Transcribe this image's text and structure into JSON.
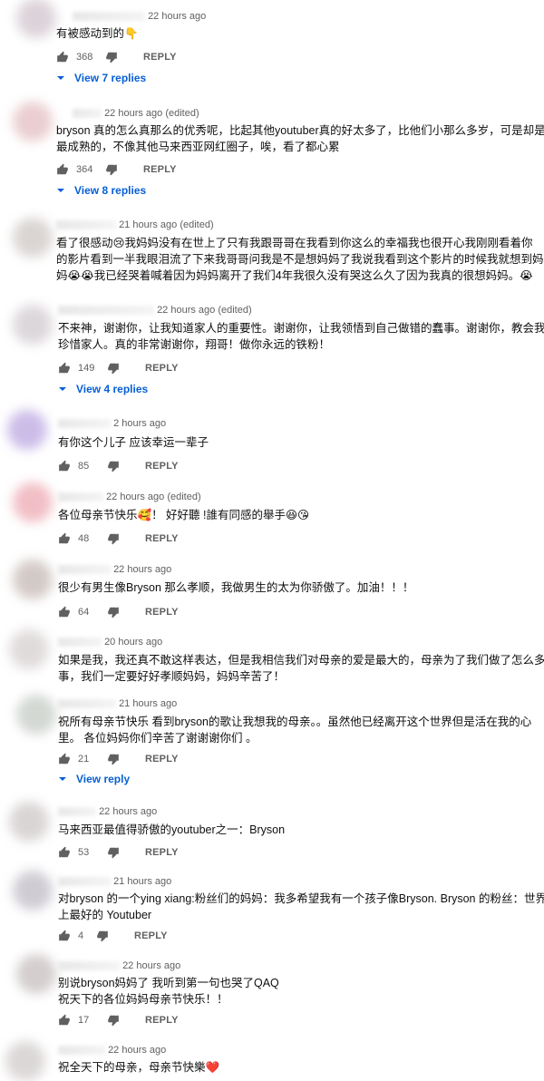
{
  "reply_label": "REPLY",
  "comments": [
    {
      "time": "22 hours ago",
      "text": [
        "有被感动到的👇"
      ],
      "likes": "368",
      "view_replies": "View 7 replies"
    },
    {
      "time": "22 hours ago (edited)",
      "text_prefix": "bryson",
      "text": [
        "bryson 真的怎么真那么的优秀呢，比起其他youtuber真的好太多了，比他们小那么多岁，可是却是",
        "最成熟的，不像其他马来西亚网红圈子，唉，看了都心累"
      ],
      "likes": "364",
      "view_replies": "View 8 replies"
    },
    {
      "time": "21 hours ago (edited)",
      "text": [
        "看了很感动😢我妈妈没有在世上了只有我跟哥哥在我看到你这么的幸福我也很开心我刚刚看着你",
        "的影片看到一半我眼泪流了下来我哥哥问我是不是想妈妈了我说我看到这个影片的时候我就想到妈",
        "妈😭😭我已经哭着喊着因为妈妈离开了我们4年我很久没有哭这么久了因为我真的很想妈妈。😭"
      ],
      "likes": "",
      "view_replies": ""
    },
    {
      "time": "22 hours ago (edited)",
      "text": [
        "不来神，谢谢你，让我知道家人的重要性。谢谢你，让我领悟到自己做错的蠢事。谢谢你，教会我",
        "珍惜家人。真的非常谢谢你，翔哥！做你永远的铁粉！"
      ],
      "likes": "149",
      "view_replies": "View 4 replies"
    },
    {
      "time": "2 hours ago",
      "text": [
        "有你这个儿子 应该幸运一辈子"
      ],
      "likes": "85",
      "view_replies": ""
    },
    {
      "time": "22 hours ago (edited)",
      "text": [
        "各位母亲节快乐🥰！ 好好聽 !誰有同感的舉手😆😘"
      ],
      "likes": "48",
      "view_replies": ""
    },
    {
      "time": "22 hours ago",
      "text": [
        "很少有男生像Bryson 那么孝顺，我做男生的太为你骄傲了。加油！！！"
      ],
      "likes": "64",
      "view_replies": ""
    },
    {
      "time": "20 hours ago",
      "text": [
        "如果是我，我还真不敢这样表达，但是我相信我们对母亲的爱是最大的，母亲为了我们做了怎么多",
        "事，我们一定要好好孝顺妈妈，妈妈辛苦了！"
      ],
      "likes": "",
      "view_replies": ""
    },
    {
      "time": "21 hours ago",
      "text": [
        "祝所有母亲节快乐 看到bryson的歌让我想我的母亲。。虽然他已经离开这个世界但是活在我的心",
        "里。 各位妈妈你们辛苦了谢谢谢你们 。"
      ],
      "likes": "21",
      "view_replies": "View reply"
    },
    {
      "time": "22 hours ago",
      "text": [
        "马来西亚最值得骄傲的youtuber之一：Bryson"
      ],
      "likes": "53",
      "view_replies": ""
    },
    {
      "time": "21 hours ago",
      "text": [
        "对bryson 的一个ying xiang:粉丝们的妈妈：我多希望我有一个孩子像Bryson. Bryson 的粉丝：世界",
        "上最好的 Youtuber"
      ],
      "likes": "4",
      "view_replies": ""
    },
    {
      "time": "22 hours ago",
      "text": [
        "别说bryson妈妈了 我听到第一句也哭了QAQ",
        "祝天下的各位妈妈母亲节快乐！！"
      ],
      "likes": "17",
      "view_replies": ""
    },
    {
      "time": "22 hours ago",
      "text": [
        "祝全天下的母亲，母亲节快樂❤️"
      ],
      "likes": "",
      "view_replies": ""
    }
  ],
  "avatar_colors": [
    "#d9cfd6",
    "#e8c9cc",
    "#d6d1cf",
    "#d9d3d8",
    "#c7b6e6",
    "#f0b8c0",
    "#cfc5c2",
    "#ddd8d8",
    "#cfd4cf",
    "#d5d1d0",
    "#cbc7cf",
    "#d0c9c9",
    "#d8d3d3"
  ]
}
